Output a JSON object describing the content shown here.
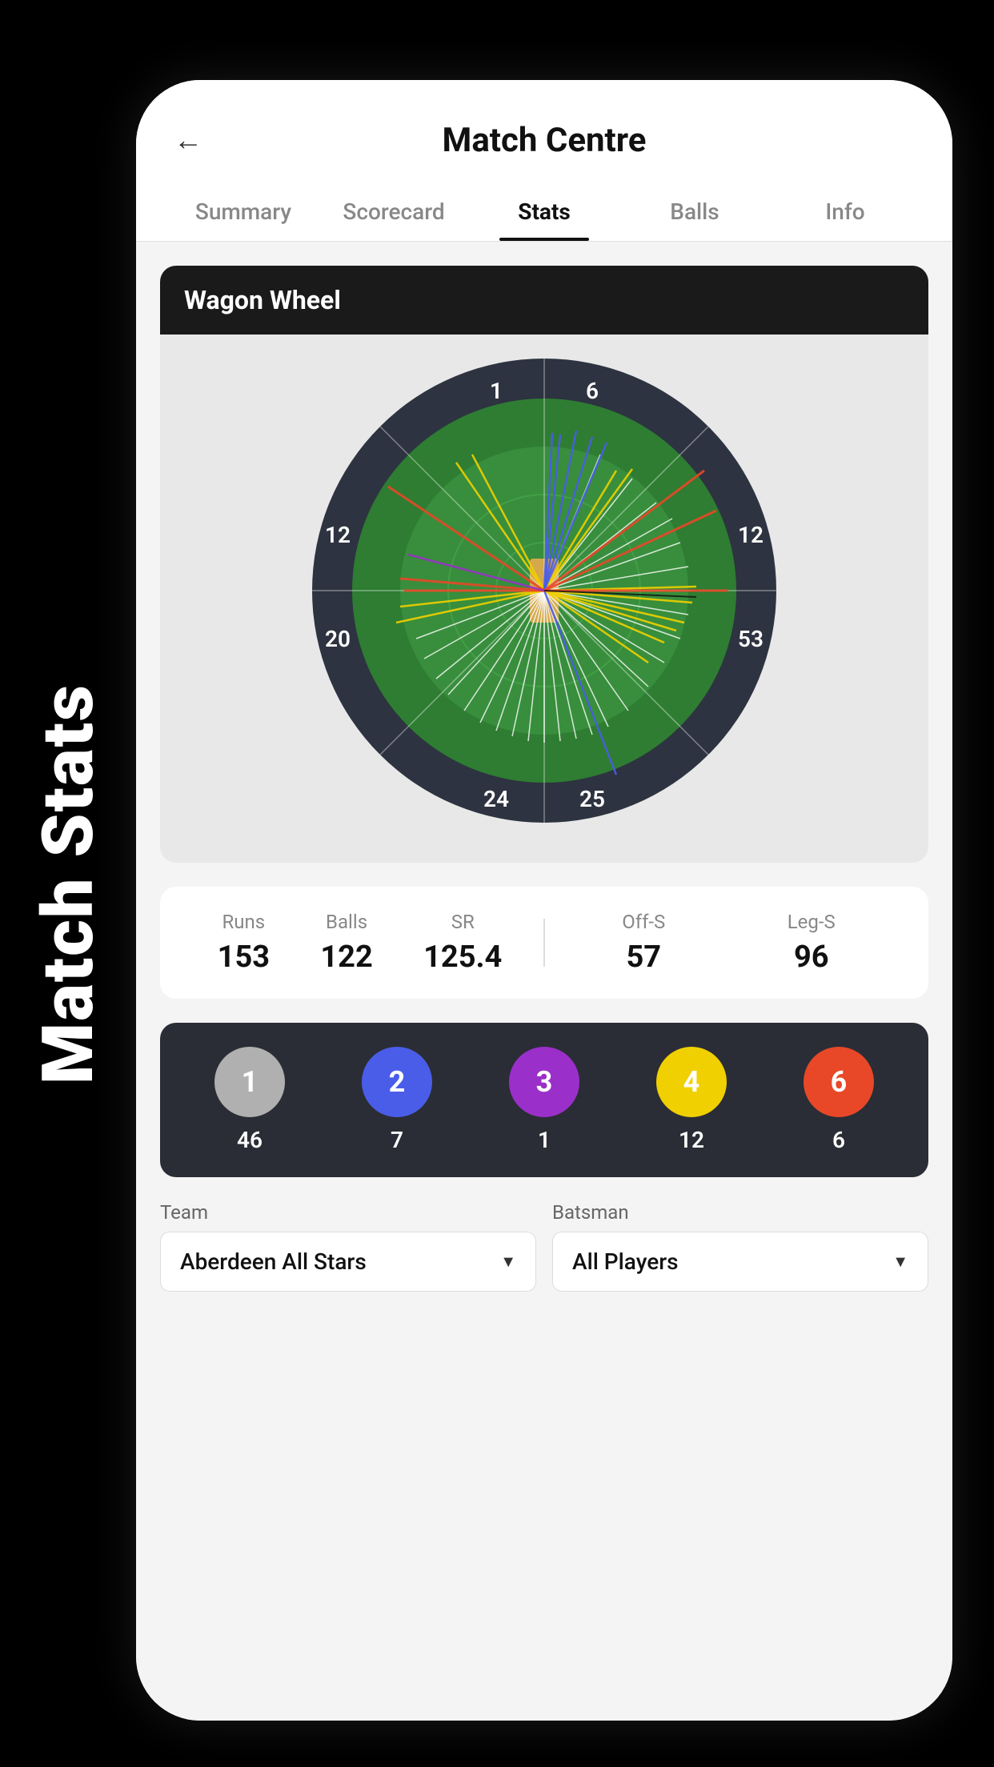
{
  "sideLabel": "Match Stats",
  "header": {
    "title": "Match Centre",
    "backLabel": "←"
  },
  "tabs": [
    {
      "id": "summary",
      "label": "Summary",
      "active": false
    },
    {
      "id": "scorecard",
      "label": "Scorecard",
      "active": false
    },
    {
      "id": "stats",
      "label": "Stats",
      "active": true
    },
    {
      "id": "balls",
      "label": "Balls",
      "active": false
    },
    {
      "id": "info",
      "label": "Info",
      "active": false
    }
  ],
  "wagonWheel": {
    "title": "Wagon Wheel",
    "zones": {
      "topLeft": "1",
      "topRight": "6",
      "leftTop": "12",
      "rightTop": "12",
      "leftBottom": "20",
      "rightBottom": "53",
      "bottomLeft": "24",
      "bottomRight": "25"
    }
  },
  "stats": {
    "runs": {
      "label": "Runs",
      "value": "153"
    },
    "balls": {
      "label": "Balls",
      "value": "122"
    },
    "sr": {
      "label": "SR",
      "value": "125.4"
    },
    "offS": {
      "label": "Off-S",
      "value": "57"
    },
    "legS": {
      "label": "Leg-S",
      "value": "96"
    }
  },
  "runLegend": [
    {
      "value": "1",
      "color": "#b0b0b0",
      "count": "46"
    },
    {
      "value": "2",
      "color": "#4a5de8",
      "count": "7"
    },
    {
      "value": "3",
      "color": "#9b2fc9",
      "count": "1"
    },
    {
      "value": "4",
      "color": "#f0d000",
      "count": "12"
    },
    {
      "value": "6",
      "color": "#e84828",
      "count": "6"
    }
  ],
  "dropdowns": {
    "team": {
      "label": "Team",
      "value": "Aberdeen All Stars"
    },
    "batsman": {
      "label": "Batsman",
      "value": "All Players"
    }
  }
}
